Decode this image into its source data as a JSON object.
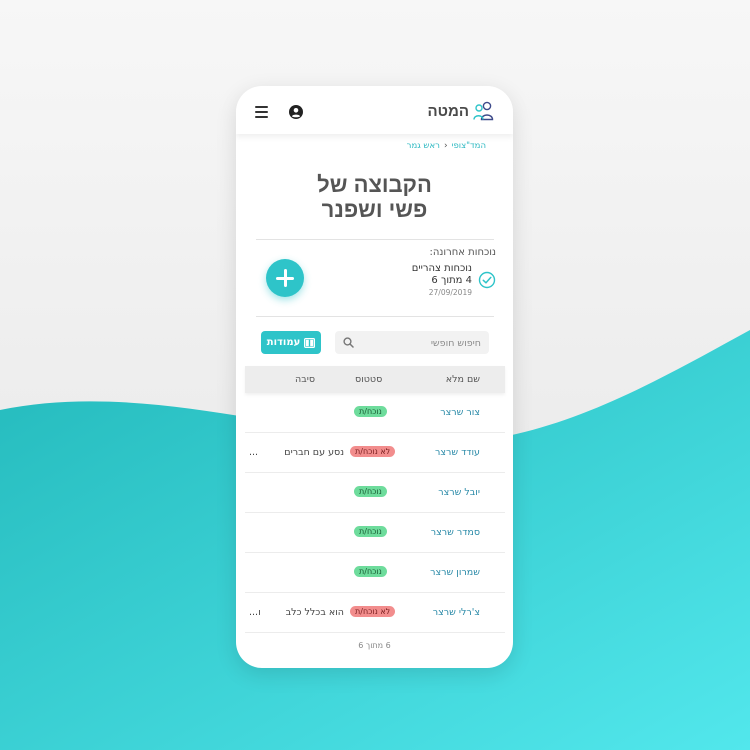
{
  "colors": {
    "accent": "#2ec4c9",
    "link": "#2a8aa8",
    "present_badge": "#6edc9c",
    "absent_badge": "#f28d8d"
  },
  "header": {
    "brand": "המטה",
    "icons": [
      "hamburger-menu-icon",
      "user-circle-icon",
      "group-users-icon"
    ]
  },
  "breadcrumb": {
    "items": [
      "המד\"צופי",
      "ראש גמר"
    ]
  },
  "page": {
    "title_line1": "הקבוצה של",
    "title_line2": "פשי ושפנר"
  },
  "attendance": {
    "label": "נוכחות אחרונה:",
    "line1": "נוכחות צהריים",
    "line2": "4 מתוך 6",
    "date": "27/09/2019"
  },
  "toolbar": {
    "search_placeholder": "חיפוש חופשי",
    "columns_label": "עמודות"
  },
  "table": {
    "headers": {
      "name": "שם מלא",
      "status": "סטטוס",
      "reason": "סיבה"
    },
    "rows": [
      {
        "name": "צור שרצר",
        "status": "נוכח/ת",
        "reason": "",
        "ellipsis": ""
      },
      {
        "name": "עודד שרצר",
        "status": "לא נוכח/ת",
        "reason": "נסע עם חברים",
        "ellipsis": "..."
      },
      {
        "name": "יובל שרצר",
        "status": "נוכח/ת",
        "reason": "",
        "ellipsis": ""
      },
      {
        "name": "סמדר שרצר",
        "status": "נוכח/ת",
        "reason": "",
        "ellipsis": ""
      },
      {
        "name": "שמרון שרצר",
        "status": "נוכח/ת",
        "reason": "",
        "ellipsis": ""
      },
      {
        "name": "צ'רלי שרצר",
        "status": "לא נוכח/ת",
        "reason": "הוא בכלל כלב",
        "ellipsis": "...ו"
      }
    ]
  },
  "footer": {
    "count": "6 מתוך 6"
  }
}
